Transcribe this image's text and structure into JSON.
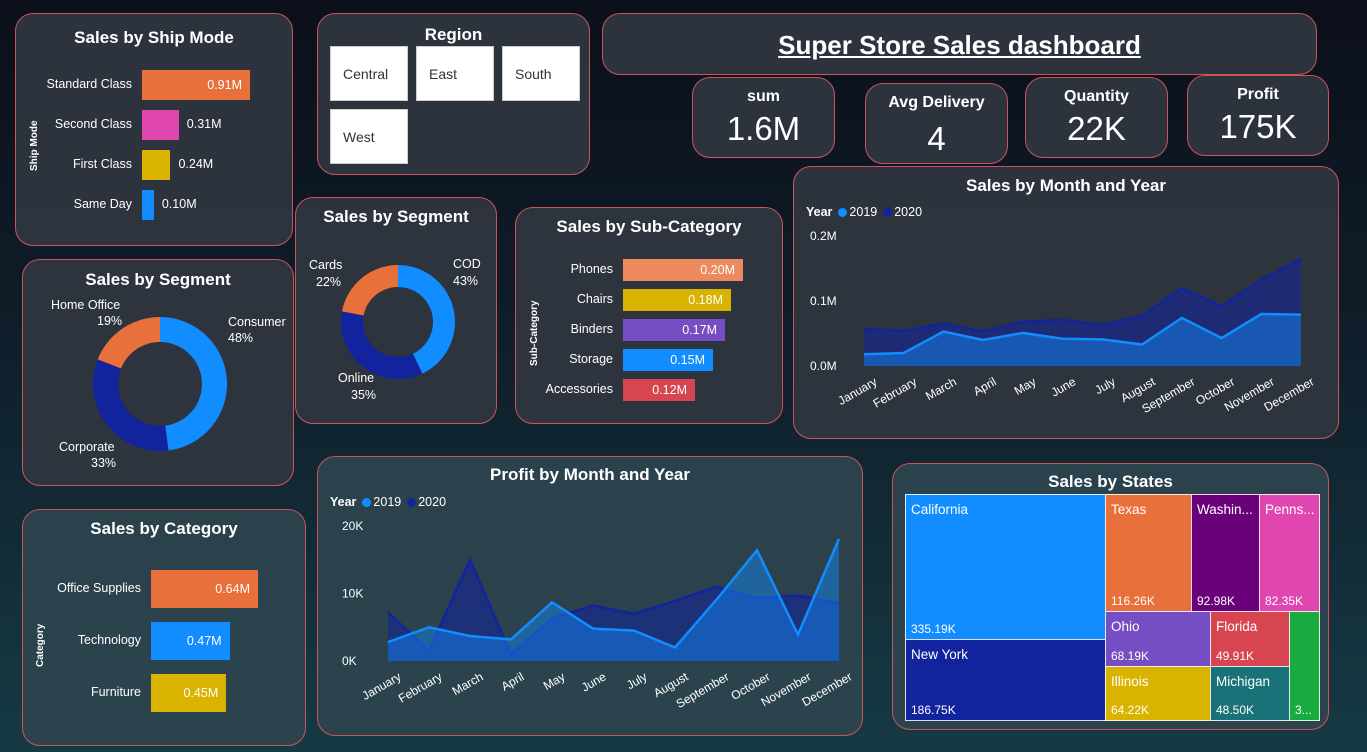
{
  "colors": {
    "orange": "#e8703a",
    "pink": "#e046b0",
    "gold": "#d9b300",
    "blue": "#118dff",
    "navy": "#12239e",
    "purple": "#744ec2",
    "red": "#d64550",
    "salmon": "#ec8a5e",
    "darkpurple": "#6b007b",
    "teal": "#197278",
    "green": "#1aab40"
  },
  "header": {
    "title": "Super Store Sales dashboard"
  },
  "kpis": [
    {
      "label": "sum",
      "value": "1.6M"
    },
    {
      "label": "Avg Delivery",
      "value": "4"
    },
    {
      "label": "Quantity",
      "value": "22K"
    },
    {
      "label": "Profit",
      "value": "175K"
    }
  ],
  "region": {
    "title": "Region",
    "options": [
      "Central",
      "East",
      "South",
      "West"
    ]
  },
  "ship_mode": {
    "title": "Sales by Ship Mode",
    "axis_label": "Ship Mode",
    "items": [
      {
        "label": "Standard Class",
        "value": 0.91,
        "text": "0.91M",
        "color": "#e8703a"
      },
      {
        "label": "Second Class",
        "value": 0.31,
        "text": "0.31M",
        "color": "#e046b0"
      },
      {
        "label": "First Class",
        "value": 0.24,
        "text": "0.24M",
        "color": "#d9b300"
      },
      {
        "label": "Same Day",
        "value": 0.1,
        "text": "0.10M",
        "color": "#118dff"
      }
    ]
  },
  "segment_customer": {
    "title": "Sales by Segment",
    "slices": [
      {
        "label": "Consumer",
        "pct": "48%",
        "value": 48,
        "color": "#118dff"
      },
      {
        "label": "Corporate",
        "pct": "33%",
        "value": 33,
        "color": "#12239e"
      },
      {
        "label": "Home Office",
        "pct": "19%",
        "value": 19,
        "color": "#e8703a"
      }
    ]
  },
  "segment_payment": {
    "title": "Sales by Segment",
    "slices": [
      {
        "label": "COD",
        "pct": "43%",
        "value": 43,
        "color": "#118dff"
      },
      {
        "label": "Online",
        "pct": "35%",
        "value": 35,
        "color": "#12239e"
      },
      {
        "label": "Cards",
        "pct": "22%",
        "value": 22,
        "color": "#e8703a"
      }
    ]
  },
  "sub_category": {
    "title": "Sales by Sub-Category",
    "axis_label": "Sub-Category",
    "items": [
      {
        "label": "Phones",
        "value": 0.2,
        "text": "0.20M",
        "color": "#ec8a5e"
      },
      {
        "label": "Chairs",
        "value": 0.18,
        "text": "0.18M",
        "color": "#d9b300"
      },
      {
        "label": "Binders",
        "value": 0.17,
        "text": "0.17M",
        "color": "#744ec2"
      },
      {
        "label": "Storage",
        "value": 0.15,
        "text": "0.15M",
        "color": "#118dff"
      },
      {
        "label": "Accessories",
        "value": 0.12,
        "text": "0.12M",
        "color": "#d64550"
      }
    ]
  },
  "category": {
    "title": "Sales by Category",
    "axis_label": "Category",
    "items": [
      {
        "label": "Office Supplies",
        "value": 0.64,
        "text": "0.64M",
        "color": "#e8703a"
      },
      {
        "label": "Technology",
        "value": 0.47,
        "text": "0.47M",
        "color": "#118dff"
      },
      {
        "label": "Furniture",
        "value": 0.45,
        "text": "0.45M",
        "color": "#d9b300"
      }
    ]
  },
  "sales_month": {
    "title": "Sales by Month and Year",
    "legend_title": "Year",
    "y_ticks": [
      "0.2M",
      "0.1M",
      "0.0M"
    ],
    "ylim": [
      0,
      0.2
    ],
    "months": [
      "January",
      "February",
      "March",
      "April",
      "May",
      "June",
      "July",
      "August",
      "September",
      "October",
      "November",
      "December"
    ],
    "series": [
      {
        "name": "2019",
        "color": "#118dff",
        "values": [
          0.018,
          0.02,
          0.053,
          0.04,
          0.051,
          0.042,
          0.041,
          0.033,
          0.074,
          0.043,
          0.08,
          0.079
        ]
      },
      {
        "name": "2020",
        "color": "#12239e",
        "values": [
          0.057,
          0.054,
          0.065,
          0.053,
          0.068,
          0.071,
          0.063,
          0.077,
          0.12,
          0.092,
          0.132,
          0.165
        ]
      }
    ]
  },
  "profit_month": {
    "title": "Profit by Month and Year",
    "legend_title": "Year",
    "y_ticks": [
      "20K",
      "10K",
      "0K"
    ],
    "ylim": [
      0,
      20000
    ],
    "months": [
      "January",
      "February",
      "March",
      "April",
      "May",
      "June",
      "July",
      "August",
      "September",
      "October",
      "November",
      "December"
    ],
    "series": [
      {
        "name": "2019",
        "color": "#118dff",
        "values": [
          2800,
          5000,
          3700,
          3200,
          8700,
          4800,
          4500,
          2000,
          9000,
          16400,
          3900,
          18100
        ]
      },
      {
        "name": "2020",
        "color": "#12239e",
        "values": [
          7200,
          1500,
          15000,
          1000,
          6300,
          8200,
          7000,
          8900,
          11000,
          9300,
          9700,
          8600
        ]
      }
    ]
  },
  "states": {
    "title": "Sales by States",
    "cells": [
      {
        "name": "California",
        "value": "335.19K",
        "color": "#118dff"
      },
      {
        "name": "New York",
        "value": "186.75K",
        "color": "#12239e"
      },
      {
        "name": "Texas",
        "value": "116.26K",
        "color": "#e8703a"
      },
      {
        "name": "Washin...",
        "value": "92.98K",
        "color": "#6b007b"
      },
      {
        "name": "Penns...",
        "value": "82.35K",
        "color": "#e046b0"
      },
      {
        "name": "Ohio",
        "value": "68.19K",
        "color": "#744ec2"
      },
      {
        "name": "Florida",
        "value": "49.91K",
        "color": "#d64550"
      },
      {
        "name": "Illinois",
        "value": "64.22K",
        "color": "#d9b300"
      },
      {
        "name": "Michigan",
        "value": "48.50K",
        "color": "#197278"
      },
      {
        "name": "",
        "value": "3...",
        "color": "#1aab40"
      }
    ]
  }
}
